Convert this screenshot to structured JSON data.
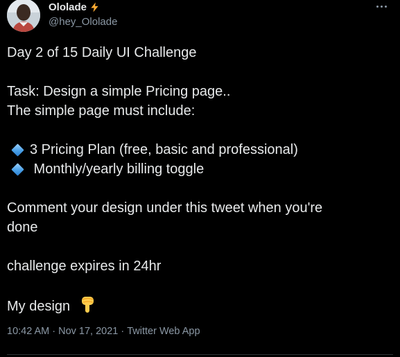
{
  "author": {
    "display_name": "Ololade",
    "handle": "@hey_Ololade",
    "badge_icon": "lightning-bolt-icon"
  },
  "tweet": {
    "line1": "Day 2 of 15 Daily UI Challenge",
    "line2": "Task: Design a simple Pricing page..",
    "line3": "The simple page must include:",
    "bullet1": "3 Pricing Plan (free, basic and professional)",
    "bullet2": " Monthly/yearly billing toggle",
    "bullet_icon": "blue-diamond-icon",
    "line4a": "Comment your design under this tweet when you're",
    "line4b": "done",
    "line5": "challenge expires in 24hr",
    "line6": "My design",
    "line6_icon": "backhand-index-pointing-down-icon"
  },
  "meta": {
    "time": "10:42 AM",
    "sep1": "·",
    "date": "Nov 17, 2021",
    "sep2": "·",
    "source": "Twitter Web App"
  },
  "colors": {
    "background": "#000000",
    "text": "#e7e9ea",
    "secondary": "#8b98a5",
    "bolt": "#ffac33",
    "diamond": "#4aa1e8"
  }
}
